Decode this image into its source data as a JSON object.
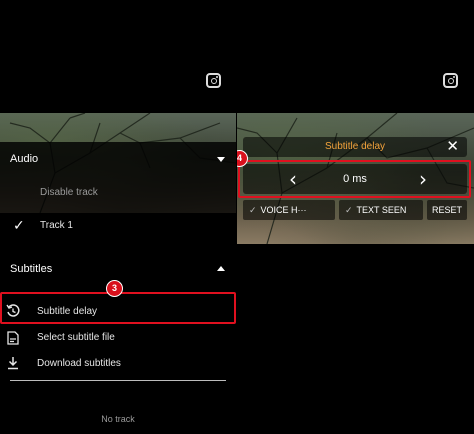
{
  "left_panel": {
    "audio": {
      "title": "Audio",
      "tracks": [
        {
          "label": "Disable track",
          "selected": false
        },
        {
          "label": "Track 1",
          "selected": true
        }
      ]
    },
    "subtitles": {
      "title": "Subtitles",
      "items": [
        {
          "label": "Subtitle delay",
          "icon": "subtitle-delay-icon"
        },
        {
          "label": "Select subtitle file",
          "icon": "subtitle-file-icon"
        },
        {
          "label": "Download subtitles",
          "icon": "download-icon"
        }
      ],
      "empty_text": "No track"
    },
    "step_badge": "3"
  },
  "right_panel": {
    "title": "Subtitle delay",
    "delay_value": "0 ms",
    "buttons": [
      "VOICE H···",
      "TEXT SEEN",
      "RESET"
    ],
    "step_badge": "4"
  },
  "colors": {
    "highlight": "#e0101f",
    "title_accent": "#f2a23b"
  }
}
